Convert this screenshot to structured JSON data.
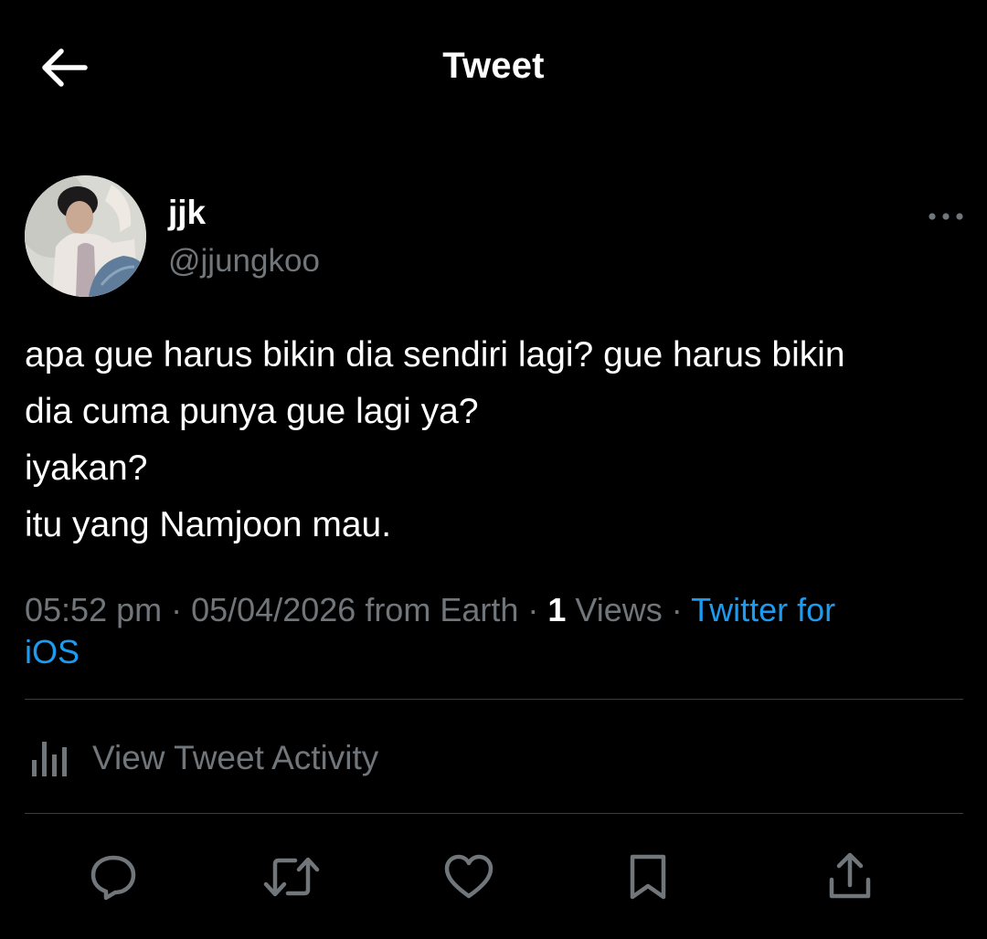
{
  "header": {
    "title": "Tweet",
    "back_icon": "arrow-left-icon"
  },
  "author": {
    "display_name": "jjk",
    "handle": "@jjungkoo",
    "more_icon": "more-horizontal-icon"
  },
  "tweet": {
    "lines": [
      "apa gue harus bikin dia sendiri lagi? gue harus bikin",
      "dia cuma punya gue lagi ya?",
      "iyakan?",
      "itu yang Namjoon mau."
    ]
  },
  "meta": {
    "time": "05:52 pm",
    "date": "05/04/2026",
    "location": "from Earth",
    "separator": " · ",
    "views_count": "1",
    "views_label": "Views",
    "source_part1": "Twitter for",
    "source_part2": "iOS"
  },
  "activity": {
    "label": "View Tweet Activity",
    "icon": "analytics-bars-icon"
  },
  "actions": {
    "icons": [
      "reply-icon",
      "retweet-icon",
      "like-icon",
      "bookmark-icon",
      "share-icon"
    ]
  },
  "colors": {
    "background": "#000000",
    "text_primary": "#ffffff",
    "text_secondary": "#71767b",
    "accent": "#1d9bf0",
    "divider": "#3a3d40"
  }
}
